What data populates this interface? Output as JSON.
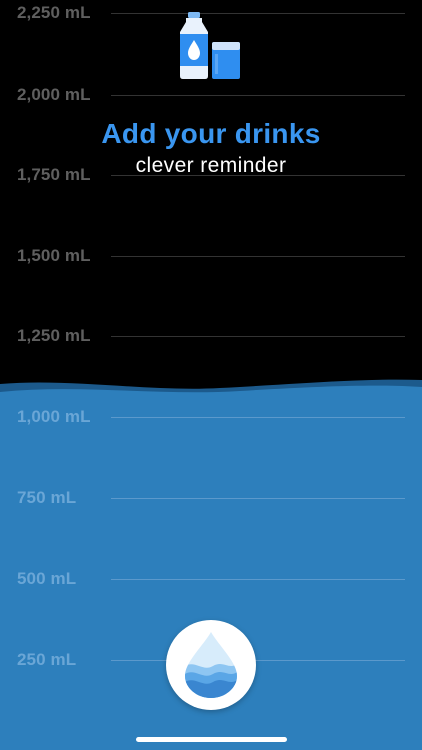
{
  "header": {
    "icon": "water-bottle-and-glass-icon",
    "title": "Add your drinks",
    "subtitle": "clever reminder"
  },
  "gauge": {
    "fill_ml": 1125,
    "levels": [
      {
        "label": "2,250 mL"
      },
      {
        "label": "2,000 mL"
      },
      {
        "label": "1,750 mL"
      },
      {
        "label": "1,500 mL"
      },
      {
        "label": "1,250 mL"
      },
      {
        "label": "1,000 mL"
      },
      {
        "label": "750 mL"
      },
      {
        "label": "500 mL"
      },
      {
        "label": "250 mL"
      }
    ]
  },
  "add_button": {
    "icon": "water-drop-icon"
  },
  "colors": {
    "background": "#000000",
    "water": "#2d7fbc",
    "accent": "#3a96f0",
    "button": "#ffffff"
  }
}
